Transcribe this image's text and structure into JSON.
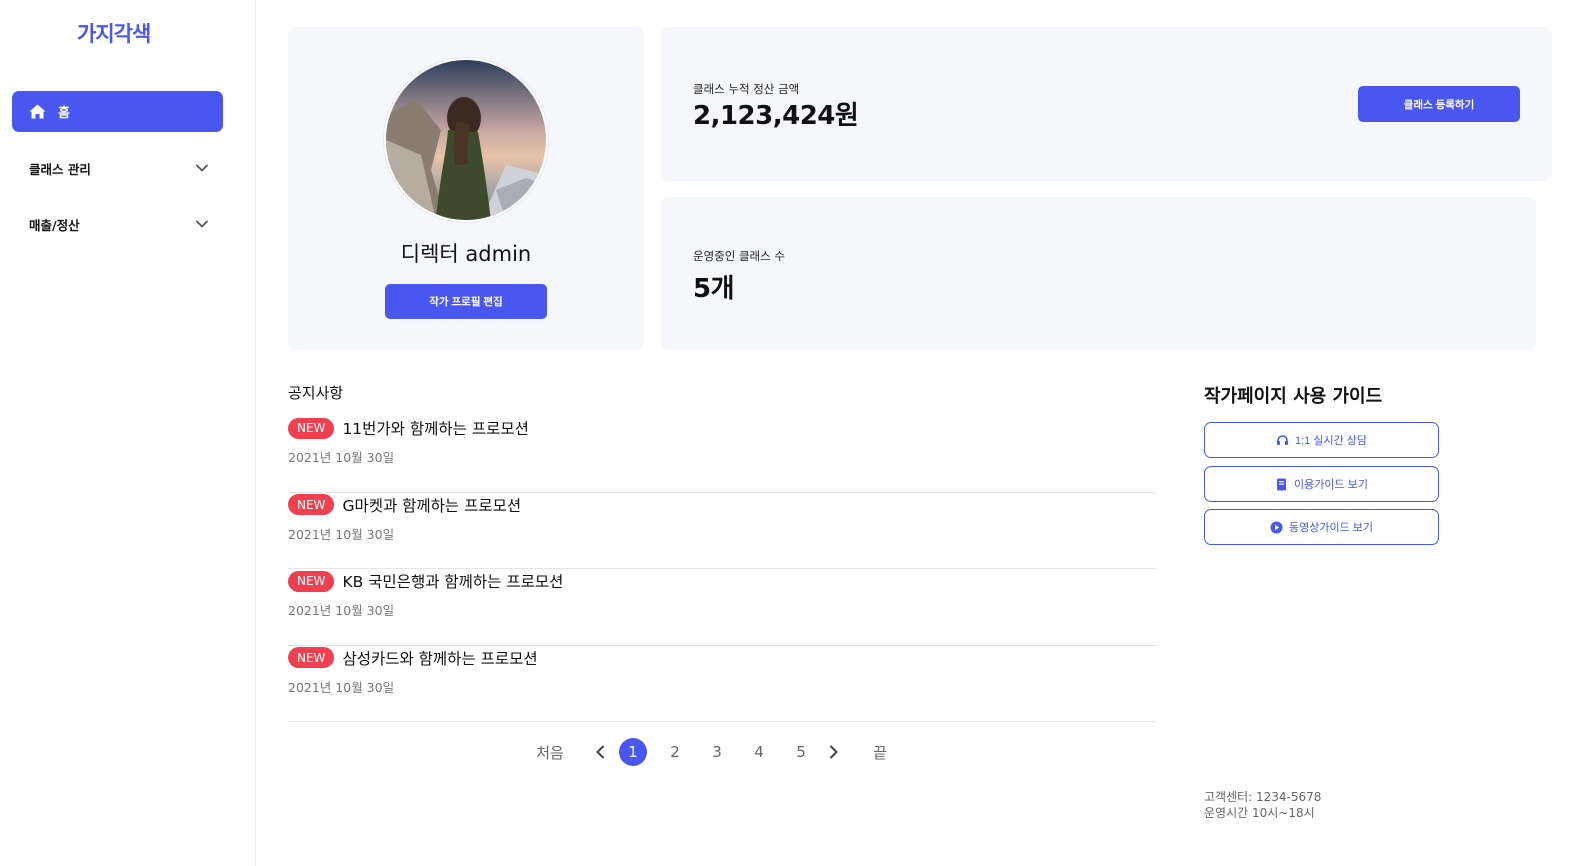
{
  "brand": {
    "logo": "가지각색",
    "accent": "#4a56f0",
    "badge_color": "#f0404f"
  },
  "sidebar": {
    "home": {
      "icon": "home-icon",
      "label": "홈"
    },
    "items": [
      {
        "label": "클래스 관리",
        "icon": "chevron-down-icon"
      },
      {
        "label": "매출/정산",
        "icon": "chevron-down-icon"
      }
    ]
  },
  "profile": {
    "name": "디렉터 admin",
    "edit_button": "작가 프로필 편집"
  },
  "stats": {
    "revenue_label": "클래스 누적 정산 금액",
    "revenue_value": "2,123,424원",
    "register_button": "클래스 등록하기",
    "count_label": "운영중인 클래스 수",
    "count_value": "5개"
  },
  "notices": {
    "title": "공지사항",
    "items": [
      {
        "badge": "NEW",
        "text": "11번가와 함께하는 프로모션",
        "date": "2021년 10월 30일"
      },
      {
        "badge": "NEW",
        "text": "G마켓과 함께하는 프로모션",
        "date": "2021년 10월 30일"
      },
      {
        "badge": "NEW",
        "text": "KB 국민은행과 함께하는 프로모션",
        "date": "2021년 10월 30일"
      },
      {
        "badge": "NEW",
        "text": "삼성카드와 함께하는 프로모션",
        "date": "2021년 10월 30일"
      }
    ]
  },
  "pagination": {
    "first": "처음",
    "last": "끝",
    "pages": [
      "1",
      "2",
      "3",
      "4",
      "5"
    ],
    "current": 1
  },
  "guide": {
    "title": "작가페이지 사용 가이드",
    "buttons": [
      {
        "label": "1:1 실시간 상담",
        "icon": "headset-icon"
      },
      {
        "label": "이용가이드 보기",
        "icon": "book-icon"
      },
      {
        "label": "동영상가이드 보기",
        "icon": "play-circle-icon"
      }
    ]
  },
  "support": {
    "phone": "고객센터: 1234-5678",
    "hours": "운영시간 10시~18시"
  }
}
